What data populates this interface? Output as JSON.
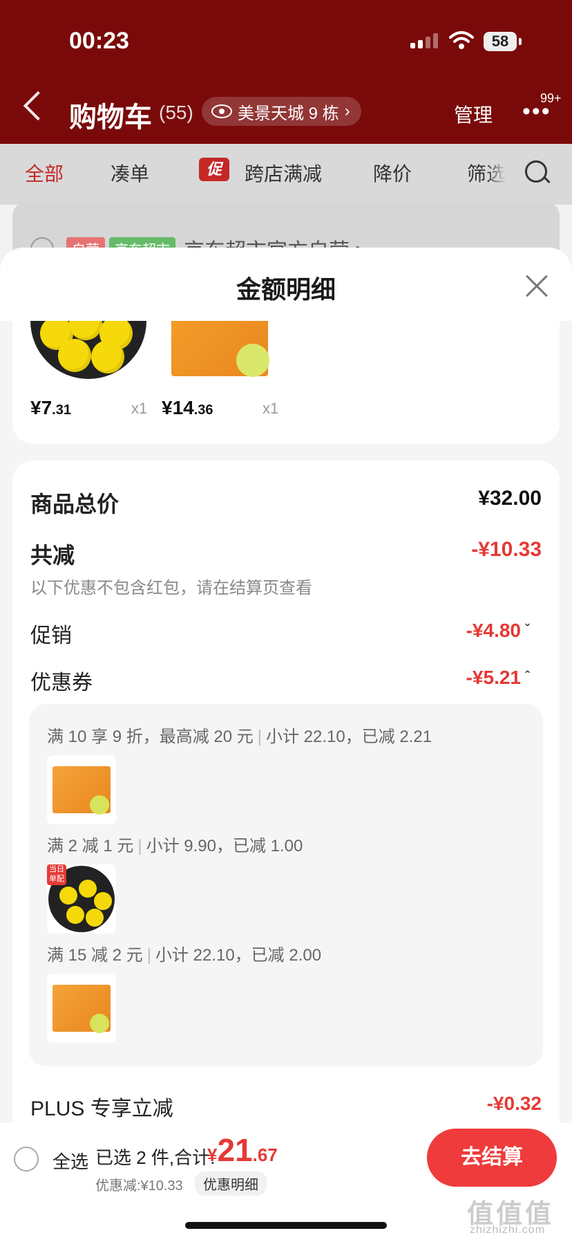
{
  "status_bar": {
    "time": "00:23",
    "battery": "58"
  },
  "nav": {
    "title": "购物车",
    "count": "(55)",
    "location": "美景天城 9 栋",
    "manage": "管理",
    "more_badge": "99+"
  },
  "tabs": [
    "全部",
    "凑单",
    "跨店满减",
    "降价",
    "筛选"
  ],
  "promo_badge": "促",
  "store": {
    "tag_self": "自营",
    "tag_market": "京东超市",
    "name": "京东超市官方自营 >"
  },
  "sheet": {
    "title": "金额明细",
    "products": [
      {
        "price_int": "¥7",
        "price_dec": ".31",
        "qty": "x1"
      },
      {
        "price_int": "¥14",
        "price_dec": ".36",
        "qty": "x1"
      }
    ],
    "rows": {
      "total_label": "商品总价",
      "total_value": "¥32.00",
      "reduce_label": "共减",
      "reduce_value": "-¥10.33",
      "reduce_note": "以下优惠不包含红包，请在结算页查看",
      "promo_label": "促销",
      "promo_value": "-¥4.80",
      "coupon_label": "优惠券",
      "coupon_value": "-¥5.21",
      "plus_label": "PLUS 专享立减",
      "plus_value": "-¥0.32"
    },
    "coupons": [
      {
        "rule": "满 10 享 9 折，最高减 20 元",
        "detail": "小计 22.10，已减 2.21"
      },
      {
        "rule": "满 2 减 1 元",
        "detail": "小计 9.90，已减 1.00"
      },
      {
        "rule": "满 15 减 2 元",
        "detail": "小计 22.10，已减 2.00"
      }
    ],
    "thumb_tag": "当日 单配"
  },
  "bottom": {
    "select_all": "全选",
    "selected": "已选 2 件,合计:",
    "total_cur": "¥",
    "total_int": "21",
    "total_dec": ".67",
    "discount": "优惠减:¥10.33",
    "detail_link": "优惠明细",
    "checkout": "去结算"
  },
  "watermark": {
    "main": "值值值",
    "sub": "zhizhizhi.com"
  },
  "colors": {
    "header": "#7a0a0a",
    "accent": "#e53935",
    "checkout": "#ef3b3b"
  }
}
